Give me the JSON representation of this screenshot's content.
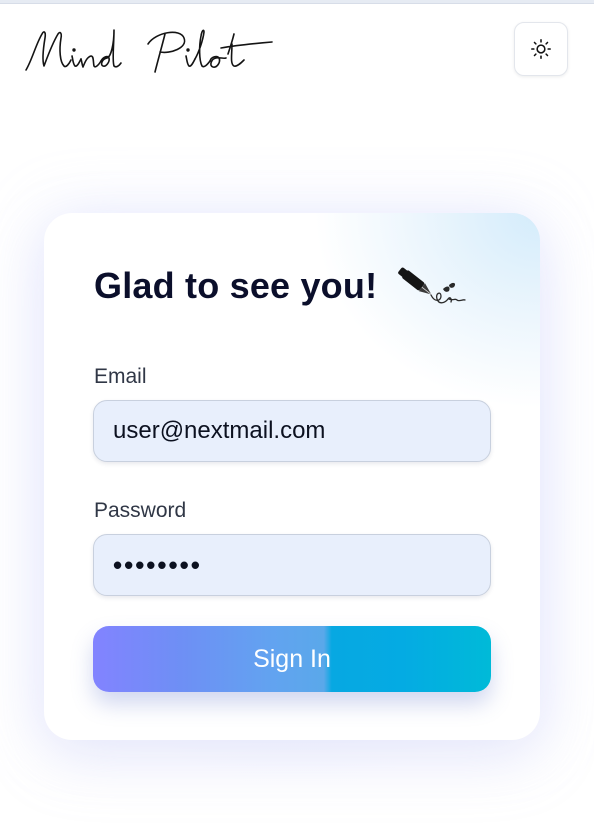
{
  "header": {
    "logo_text": "Mind Pilot",
    "theme_toggle_icon": "sun-icon"
  },
  "login": {
    "heading": "Glad to see you!",
    "heading_icon": "fountain-pen-icon",
    "email_label": "Email",
    "email_value": "user@nextmail.com",
    "password_label": "Password",
    "password_value": "••••••••",
    "submit_label": "Sign In"
  },
  "colors": {
    "heading_text": "#0b0f2b",
    "input_bg": "#e8effc",
    "button_gradient_start": "#8283ff",
    "button_gradient_end": "#00bad8"
  }
}
